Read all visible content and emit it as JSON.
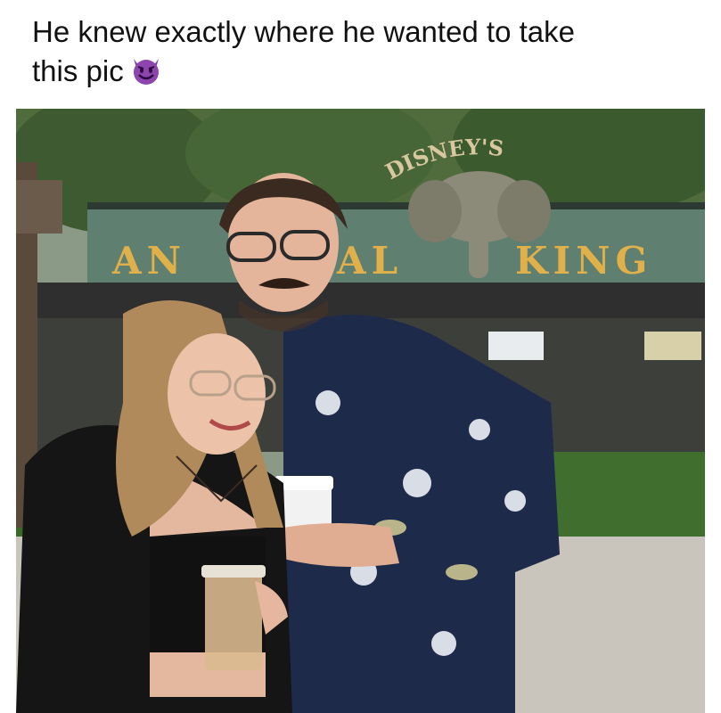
{
  "caption": {
    "line1": "He knew exactly where he wanted to take",
    "line2": "this pic"
  },
  "emoji": {
    "icon": "smiling-devil-emoji",
    "color": "#8e44ad"
  },
  "photo": {
    "sign_top": "DISNEY'S",
    "sign_letters": [
      "AN",
      "AL",
      "KING"
    ],
    "booth_sign": "",
    "colors": {
      "sky": "#b8c3c9",
      "foliage": "#3b5a2e",
      "roof": "#2f2f2f",
      "sign_gold": "#e0b04a",
      "shirt": "#1d2a4a",
      "jacket": "#151515",
      "hair_woman": "#b08a5a",
      "skin": "#e7b9a0",
      "ground": "#c9c5bd"
    }
  }
}
